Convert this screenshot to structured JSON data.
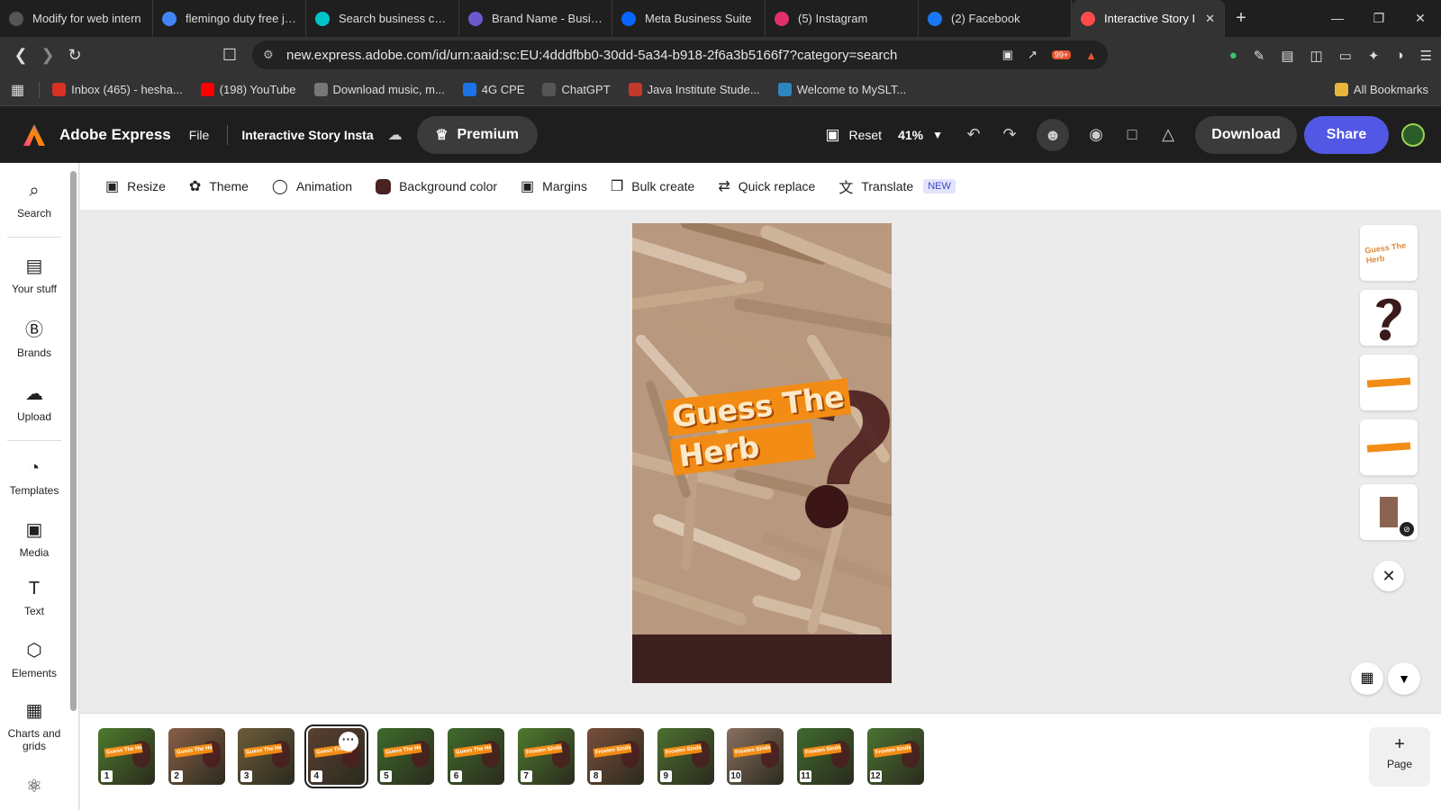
{
  "browser": {
    "tabs": [
      {
        "label": "Modify for web intern",
        "icon": "openai-icon",
        "color": "#555555"
      },
      {
        "label": "flemingo duty free job",
        "icon": "google-icon",
        "color": "#4285f4"
      },
      {
        "label": "Search business card",
        "icon": "canva-icon",
        "color": "#00c4cc"
      },
      {
        "label": "Brand Name - Busine",
        "icon": "forms-icon",
        "color": "#6a5acd"
      },
      {
        "label": "Meta Business Suite",
        "icon": "meta-icon",
        "color": "#0866ff"
      },
      {
        "label": "(5) Instagram",
        "icon": "instagram-icon",
        "color": "#e1306c"
      },
      {
        "label": "(2) Facebook",
        "icon": "facebook-icon",
        "color": "#1877f2"
      },
      {
        "label": "Interactive Story I",
        "icon": "adobe-express-icon",
        "color": "#ff4a4a",
        "active": true
      }
    ],
    "url": "new.express.adobe.com/id/urn:aaid:sc:EU:4dddfbb0-30dd-5a34-b918-2f6a3b5166f7?category=search",
    "brave_badge": "99+",
    "bookmarks": [
      {
        "label": "Inbox (465) - hesha...",
        "icon": "gmail-icon",
        "color": "#d93025"
      },
      {
        "label": "(198) YouTube",
        "icon": "youtube-icon",
        "color": "#ff0000"
      },
      {
        "label": "Download music, m...",
        "icon": "download-site-icon",
        "color": "#777777"
      },
      {
        "label": "4G CPE",
        "icon": "router-icon",
        "color": "#1a73e8"
      },
      {
        "label": "ChatGPT",
        "icon": "openai-icon",
        "color": "#555555"
      },
      {
        "label": "Java Institute Stude...",
        "icon": "java-icon",
        "color": "#c0392b"
      },
      {
        "label": "Welcome to MySLT...",
        "icon": "slt-icon",
        "color": "#2e86c1"
      }
    ],
    "all_bookmarks": "All Bookmarks"
  },
  "app": {
    "name": "Adobe Express",
    "file": "File",
    "doc_name": "Interactive Story Insta",
    "premium": "Premium",
    "reset": "Reset",
    "zoom": "41%",
    "download": "Download",
    "share": "Share",
    "share_color": "#5258e4"
  },
  "sidebar": {
    "items": [
      {
        "label": "Search",
        "icon": "search-icon"
      },
      {
        "label": "Your stuff",
        "icon": "folder-icon"
      },
      {
        "label": "Brands",
        "icon": "brands-icon"
      },
      {
        "label": "Upload",
        "icon": "upload-icon"
      },
      {
        "label": "Templates",
        "icon": "templates-icon"
      },
      {
        "label": "Media",
        "icon": "media-icon"
      },
      {
        "label": "Text",
        "icon": "text-icon"
      },
      {
        "label": "Elements",
        "icon": "elements-icon"
      },
      {
        "label": "Charts and grids",
        "icon": "charts-icon"
      }
    ]
  },
  "toolbar": {
    "resize": "Resize",
    "theme": "Theme",
    "animation": "Animation",
    "background_color": "Background color",
    "background_swatch": "#4a2222",
    "margins": "Margins",
    "bulk_create": "Bulk create",
    "quick_replace": "Quick replace",
    "translate": "Translate",
    "new_badge": "NEW"
  },
  "canvas": {
    "headline_line1": "Guess The",
    "headline_line2": "Herb",
    "accent": "#f28c14",
    "footer_color": "#3c1f1f"
  },
  "right_panel": {
    "layer1_text": "Guess The Herb"
  },
  "pages": {
    "thumbs": [
      {
        "n": "1",
        "label": "Guess The Herb",
        "bg": "#4d7a2c"
      },
      {
        "n": "2",
        "label": "Guess The Herb",
        "bg": "#8a6048"
      },
      {
        "n": "3",
        "label": "Guess The Herb",
        "bg": "#6d5c3a"
      },
      {
        "n": "4",
        "label": "Guess The Herb",
        "bg": "#5a4032",
        "selected": true
      },
      {
        "n": "5",
        "label": "Guess The Herb",
        "bg": "#3e6b2a"
      },
      {
        "n": "6",
        "label": "Guess The Herb",
        "bg": "#3f6b2c"
      },
      {
        "n": "7",
        "label": "Frosten Sinday",
        "bg": "#4e7a2e"
      },
      {
        "n": "8",
        "label": "Frosten Sinday",
        "bg": "#7a4e3a"
      },
      {
        "n": "9",
        "label": "Frosten Sinday",
        "bg": "#4c7030"
      },
      {
        "n": "10",
        "label": "Frosten Sinday",
        "bg": "#8a7060"
      },
      {
        "n": "11",
        "label": "Frosten Sinday",
        "bg": "#3f6a2d"
      },
      {
        "n": "12",
        "label": "Frosten Sinday",
        "bg": "#4a7432"
      }
    ],
    "add_page": "Page"
  }
}
